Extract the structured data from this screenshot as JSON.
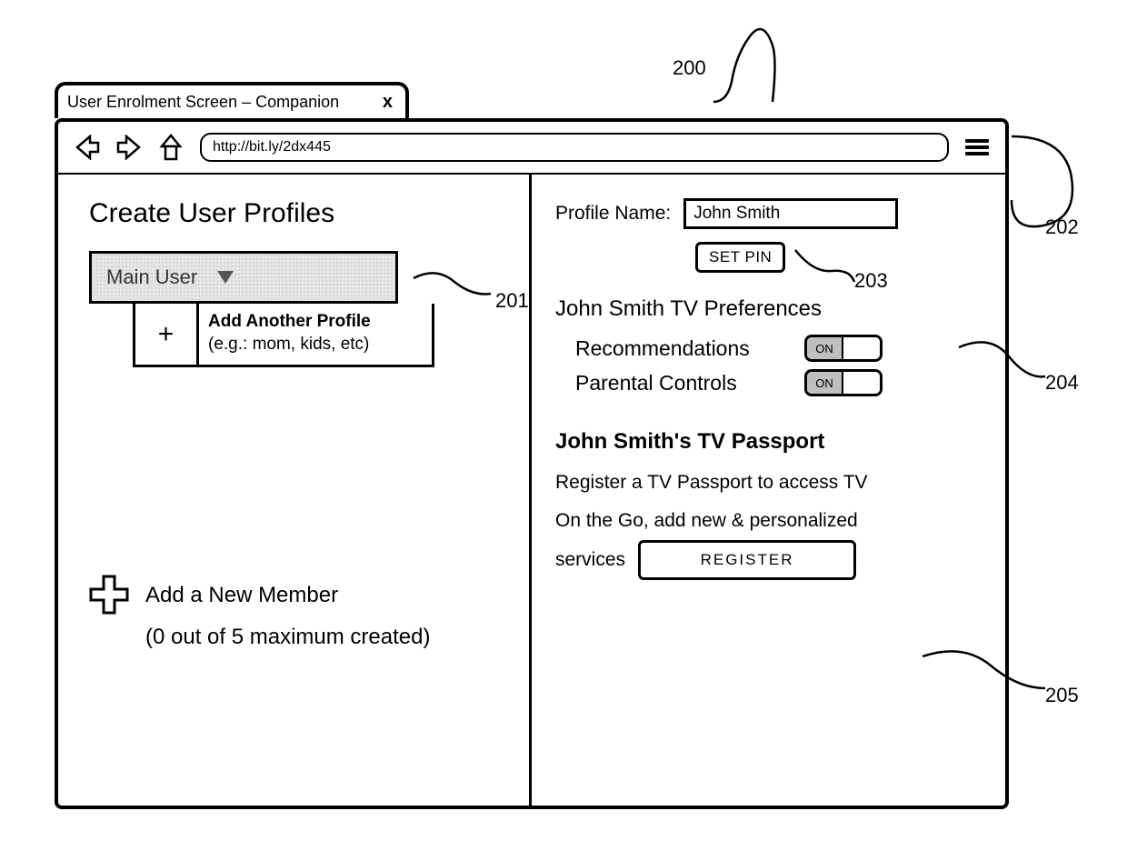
{
  "tab": {
    "title": "User Enrolment Screen – Companion",
    "close": "x"
  },
  "toolbar": {
    "url": "http://bit.ly/2dx445"
  },
  "left": {
    "heading": "Create User Profiles",
    "main_user": "Main User",
    "add_profile_title": "Add Another Profile",
    "add_profile_hint": "(e.g.: mom, kids, etc)",
    "plus_symbol": "+",
    "add_member": "Add a New Member",
    "add_member_count": "(0 out of 5 maximum created)"
  },
  "right": {
    "profile_name_label": "Profile Name:",
    "profile_name_value": "John Smith",
    "set_pin": "SET PIN",
    "prefs_heading": "John Smith  TV Preferences",
    "recommendations_label": "Recommendations",
    "parental_label": "Parental Controls",
    "toggle_on": "ON",
    "passport_heading": "John Smith's TV Passport",
    "passport_line1": "Register a TV Passport to access TV",
    "passport_line2": "On the Go, add new & personalized",
    "passport_line3_prefix": "services",
    "register": "REGISTER"
  },
  "callouts": {
    "c200": "200",
    "c201": "201",
    "c202": "202",
    "c203": "203",
    "c204": "204",
    "c205": "205"
  }
}
